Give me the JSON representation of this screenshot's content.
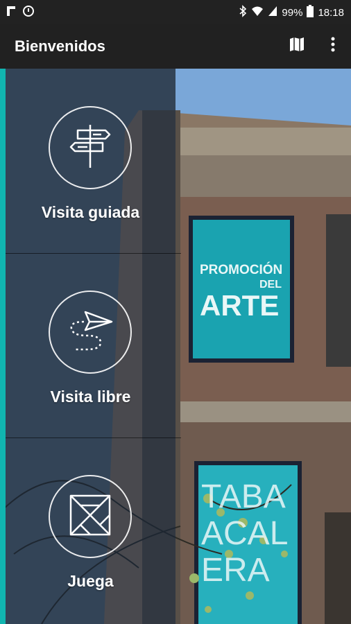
{
  "status_bar": {
    "battery": "99%",
    "time": "18:18",
    "icons": [
      "notification-f-icon",
      "sync-icon",
      "bluetooth-icon",
      "wifi-icon",
      "signal-icon",
      "battery-icon"
    ]
  },
  "app_bar": {
    "title": "Bienvenidos",
    "actions": [
      "map-icon",
      "more-vert-icon"
    ]
  },
  "menu": {
    "items": [
      {
        "label": "Visita guiada",
        "icon": "signpost-icon"
      },
      {
        "label": "Visita libre",
        "icon": "paper-plane-path-icon"
      },
      {
        "label": "Juega",
        "icon": "tangram-icon"
      }
    ]
  },
  "background": {
    "banner_1": {
      "line1": "PROMOCIÓN",
      "line2": "DEL",
      "line3": "ARTE"
    },
    "banner_2": {
      "line1": "TABA",
      "line2": "ACAL",
      "line3": "ERA"
    }
  },
  "colors": {
    "accent": "#11b5b0",
    "app_bar": "#212121",
    "status_bar": "#222222",
    "banner": "#1aa3b0"
  }
}
